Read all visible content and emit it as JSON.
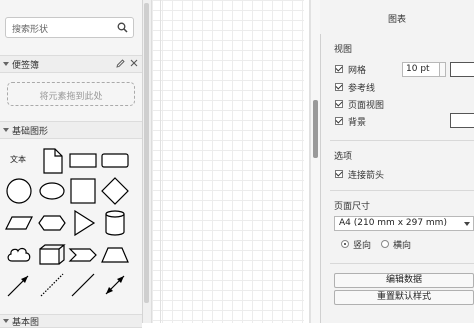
{
  "left_panel": {
    "search": {
      "placeholder": "搜索形状"
    },
    "scratchpad": {
      "title": "便签簿",
      "drop_hint": "将元素拖到此处"
    },
    "general": {
      "title": "基础图形",
      "text_shape_label": "文本"
    },
    "next_section": {
      "title": "基本图"
    }
  },
  "right_panel": {
    "tab_title": "图表",
    "view": {
      "title": "视图",
      "grid_label": "网格",
      "grid_size": "10 pt",
      "guides_label": "参考线",
      "page_view_label": "页面视图",
      "background_label": "背景",
      "grid_checked": true,
      "guides_checked": true,
      "page_view_checked": true,
      "background_checked": true
    },
    "options": {
      "title": "选项",
      "connection_arrows_label": "连接箭头",
      "connection_arrows_checked": true
    },
    "page_size": {
      "title": "页面尺寸",
      "selected": "A4 (210 mm x 297 mm)",
      "portrait_label": "竖向",
      "landscape_label": "横向",
      "orientation": "portrait"
    },
    "buttons": {
      "edit_data": "编辑数据",
      "reset_style": "重置默认样式"
    }
  },
  "icons": [
    "search-icon",
    "edit-icon",
    "close-icon",
    "collapse-triangle-icon"
  ]
}
